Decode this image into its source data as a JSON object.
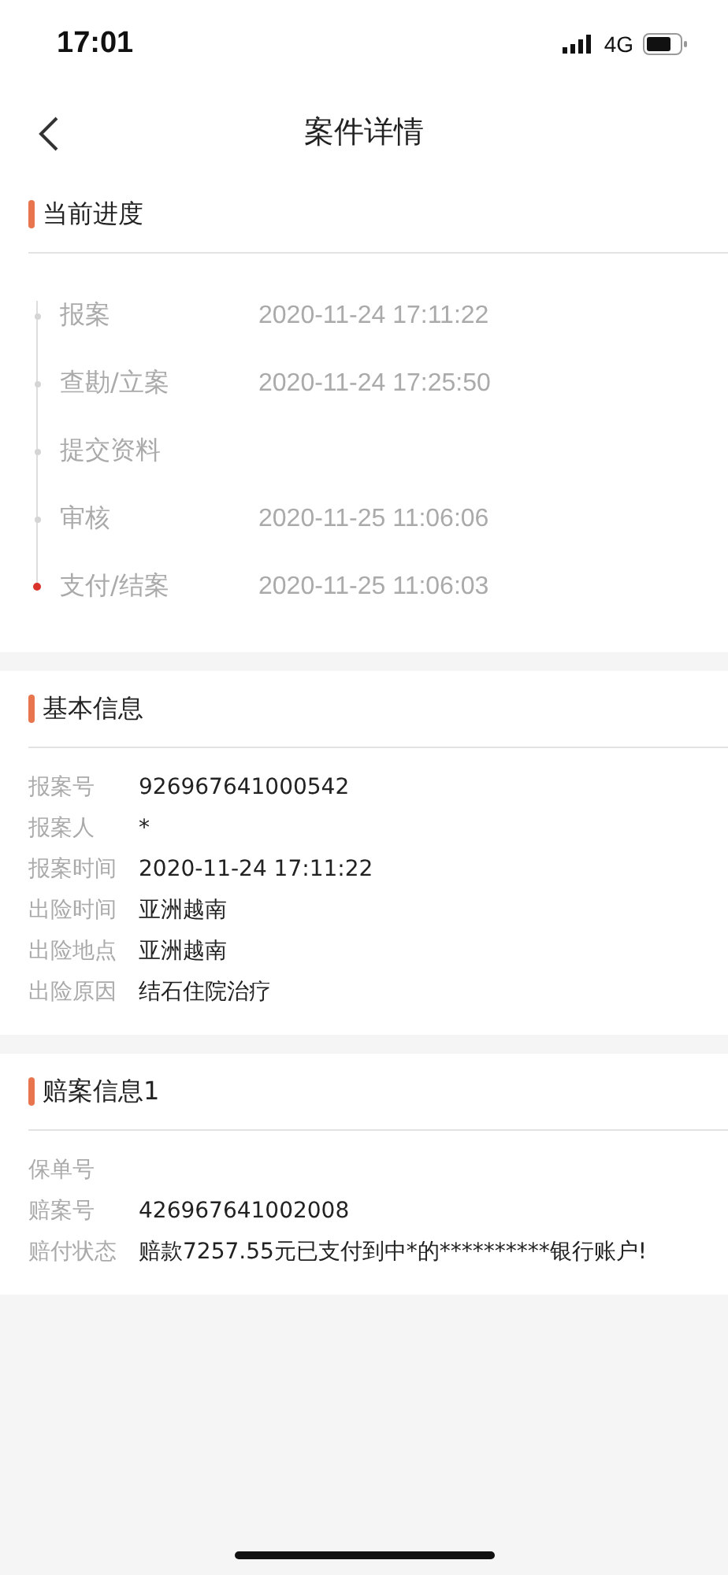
{
  "status_bar": {
    "time": "17:01",
    "network": "4G"
  },
  "nav": {
    "title": "案件详情"
  },
  "progress": {
    "title": "当前进度",
    "steps": [
      {
        "label": "报案",
        "time": "2020-11-24 17:11:22",
        "current": false
      },
      {
        "label": "查勘/立案",
        "time": "2020-11-24 17:25:50",
        "current": false
      },
      {
        "label": "提交资料",
        "current": false
      },
      {
        "label": "审核",
        "time": "2020-11-25 11:06:06",
        "current": false
      },
      {
        "label": "支付/结案",
        "time": "2020-11-25 11:06:03",
        "current": true
      }
    ]
  },
  "basic_info": {
    "title": "基本信息",
    "fields": [
      {
        "label": "报案号",
        "value": "926967641000542"
      },
      {
        "label": "报案人",
        "value": "*"
      },
      {
        "label": "报案时间",
        "value": "2020-11-24 17:11:22"
      },
      {
        "label": "出险时间",
        "value": "亚洲越南"
      },
      {
        "label": "出险地点",
        "value": "亚洲越南"
      },
      {
        "label": "出险原因",
        "value": "结石住院治疗"
      }
    ]
  },
  "claim_info": {
    "title": "赔案信息1",
    "fields": [
      {
        "label": "保单号"
      },
      {
        "label": "赔案号",
        "value": "426967641002008"
      },
      {
        "label": "赔付状态",
        "value": "赔款7257.55元已支付到中*的**********银行账户!"
      }
    ]
  }
}
